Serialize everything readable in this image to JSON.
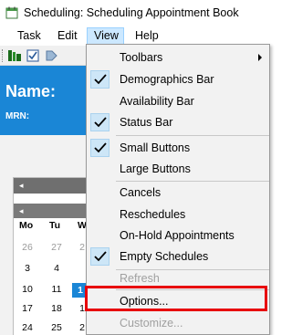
{
  "window": {
    "title": "Scheduling: Scheduling Appointment Book"
  },
  "menubar": {
    "items": [
      {
        "label": "Task"
      },
      {
        "label": "Edit"
      },
      {
        "label": "View"
      },
      {
        "label": "Help"
      }
    ]
  },
  "header": {
    "name_label": "Name:",
    "mrn_label": "MRN:"
  },
  "calendar": {
    "nav_left": "◂",
    "nav_left2": "◂",
    "weekday_headers": [
      "Mo",
      "Tu",
      "W"
    ],
    "rows": [
      [
        "26",
        "27",
        "2"
      ],
      [
        "3",
        "4",
        ""
      ],
      [
        "10",
        "11",
        "1"
      ],
      [
        "17",
        "18",
        "1"
      ],
      [
        "24",
        "25",
        "2"
      ]
    ],
    "today": "1"
  },
  "view_menu": {
    "items": [
      {
        "label": "Toolbars",
        "checked": false,
        "submenu": true,
        "disabled": false
      },
      {
        "label": "Demographics Bar",
        "checked": true,
        "disabled": false
      },
      {
        "label": "Availability Bar",
        "checked": false,
        "disabled": false
      },
      {
        "label": "Status Bar",
        "checked": true,
        "disabled": false
      },
      {
        "label": "Small Buttons",
        "checked": true,
        "disabled": false
      },
      {
        "label": "Large Buttons",
        "checked": false,
        "disabled": false
      },
      {
        "label": "Cancels",
        "checked": false,
        "disabled": false
      },
      {
        "label": "Reschedules",
        "checked": false,
        "disabled": false
      },
      {
        "label": "On-Hold Appointments",
        "checked": false,
        "disabled": false
      },
      {
        "label": "Empty Schedules",
        "checked": true,
        "disabled": false
      },
      {
        "label": "Refresh",
        "checked": false,
        "disabled": true
      },
      {
        "label": "Options...",
        "checked": false,
        "disabled": false
      },
      {
        "label": "Customize...",
        "checked": false,
        "disabled": true
      }
    ]
  },
  "colors": {
    "header_blue": "#1a86d6",
    "highlight_red": "#e8000b",
    "check_bg": "#cde6f7"
  }
}
